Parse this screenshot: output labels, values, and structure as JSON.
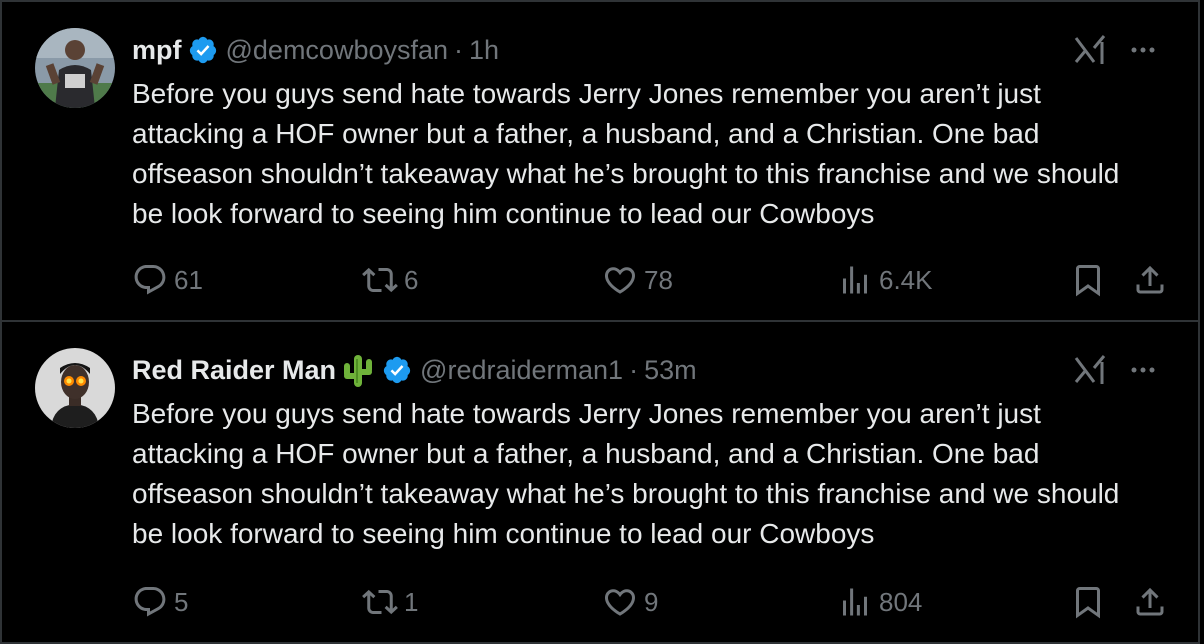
{
  "tweets": [
    {
      "display_name": "mpf",
      "verified": true,
      "handle": "@demcowboysfan",
      "separator": "·",
      "time": "1h",
      "text": "Before you guys send hate towards Jerry Jones remember you aren’t just attacking a HOF owner but a father, a husband, and a Christian. One bad offseason shouldn’t takeaway what he’s brought to this franchise and we should be look forward to seeing him continue to lead our Cowboys",
      "replies": "61",
      "reposts": "6",
      "likes": "78",
      "views": "6.4K"
    },
    {
      "display_name": "Red Raider Man",
      "verified": true,
      "name_emoji": "cactus",
      "handle": "@redraiderman1",
      "separator": "·",
      "time": "53m",
      "text": "Before you guys send hate towards Jerry Jones remember you aren’t just attacking a HOF owner but a father, a husband, and a Christian. One bad offseason shouldn’t takeaway what he’s brought to this franchise and we should be look forward to seeing him continue to lead our Cowboys",
      "replies": "5",
      "reposts": "1",
      "likes": "9",
      "views": "804"
    }
  ],
  "colors": {
    "background": "#000000",
    "text": "#e7e9ea",
    "muted": "#71767b",
    "border": "#2f3336",
    "verified": "#1d9bf0"
  },
  "icons": [
    "verified-badge-icon",
    "grok-icon",
    "more-icon",
    "reply-icon",
    "repost-icon",
    "like-icon",
    "views-icon",
    "bookmark-icon",
    "share-icon",
    "cactus-icon"
  ]
}
